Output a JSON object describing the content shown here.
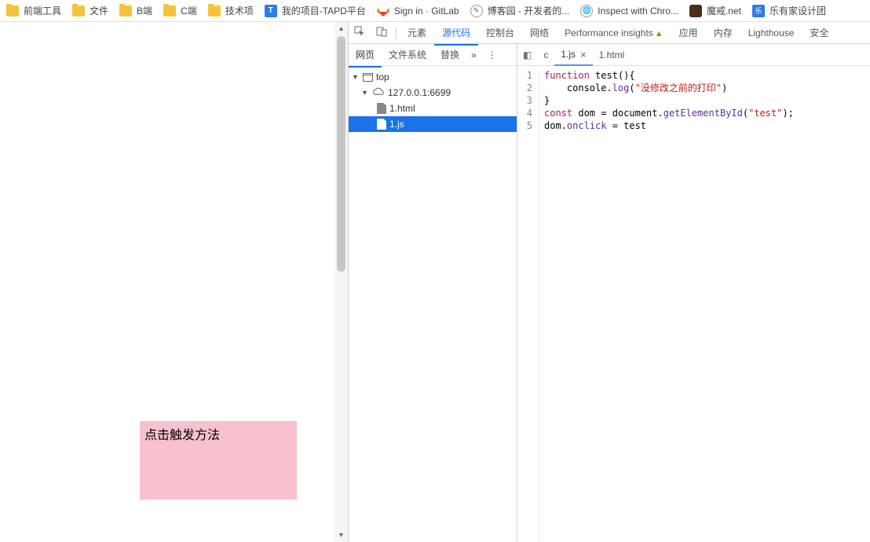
{
  "bookmarks": {
    "items": [
      {
        "label": "前端工具",
        "type": "folder"
      },
      {
        "label": "文件",
        "type": "folder"
      },
      {
        "label": "B端",
        "type": "folder"
      },
      {
        "label": "C端",
        "type": "folder"
      },
      {
        "label": "技术项",
        "type": "folder"
      },
      {
        "label": "我的项目-TAPD平台",
        "type": "tapd"
      },
      {
        "label": "Sign in · GitLab",
        "type": "gitlab"
      },
      {
        "label": "博客园 - 开发者的...",
        "type": "cnblogs"
      },
      {
        "label": "Inspect with Chro...",
        "type": "inspect"
      },
      {
        "label": "魔戒.net",
        "type": "mojie"
      },
      {
        "label": "乐有家设计团",
        "type": "leyou"
      }
    ]
  },
  "page": {
    "pink_box_text": "点击触发方法"
  },
  "devtools": {
    "tabs": {
      "elements": "元素",
      "sources": "源代码",
      "console": "控制台",
      "network": "网络",
      "performance": "Performance insights",
      "app": "应用",
      "memory": "内存",
      "lighthouse": "Lighthouse",
      "security": "安全"
    },
    "source_subtabs": {
      "page": "网页",
      "filesystem": "文件系统",
      "overrides": "替换",
      "chevrons": "»"
    },
    "menu_dots": "⋮",
    "tree": {
      "top": "top",
      "host": "127.0.0.1:6699",
      "files": [
        "1.html",
        "1.js"
      ],
      "selected": "1.js"
    },
    "editor_tabs": {
      "crumb": "c",
      "file1": "1.js",
      "file2": "1.html",
      "close": "×",
      "toggle": "◧"
    },
    "code": {
      "language": "javascript",
      "lines": [
        {
          "n": "1",
          "tokens": [
            {
              "t": "kw",
              "v": "function"
            },
            {
              "t": "punc",
              "v": " "
            },
            {
              "t": "fn",
              "v": "test"
            },
            {
              "t": "punc",
              "v": "(){"
            }
          ]
        },
        {
          "n": "2",
          "tokens": [
            {
              "t": "punc",
              "v": "    console."
            },
            {
              "t": "prop",
              "v": "log"
            },
            {
              "t": "punc",
              "v": "("
            },
            {
              "t": "str",
              "v": "\"没修改之前的打印\""
            },
            {
              "t": "punc",
              "v": ")"
            }
          ]
        },
        {
          "n": "3",
          "tokens": [
            {
              "t": "punc",
              "v": "}"
            }
          ]
        },
        {
          "n": "4",
          "tokens": [
            {
              "t": "kw",
              "v": "const"
            },
            {
              "t": "punc",
              "v": " dom = document."
            },
            {
              "t": "prop",
              "v": "getElementById"
            },
            {
              "t": "punc",
              "v": "("
            },
            {
              "t": "str",
              "v": "\"test\""
            },
            {
              "t": "punc",
              "v": ");"
            }
          ]
        },
        {
          "n": "5",
          "tokens": [
            {
              "t": "punc",
              "v": "dom."
            },
            {
              "t": "prop",
              "v": "onclick"
            },
            {
              "t": "punc",
              "v": " = test"
            }
          ]
        }
      ]
    }
  }
}
